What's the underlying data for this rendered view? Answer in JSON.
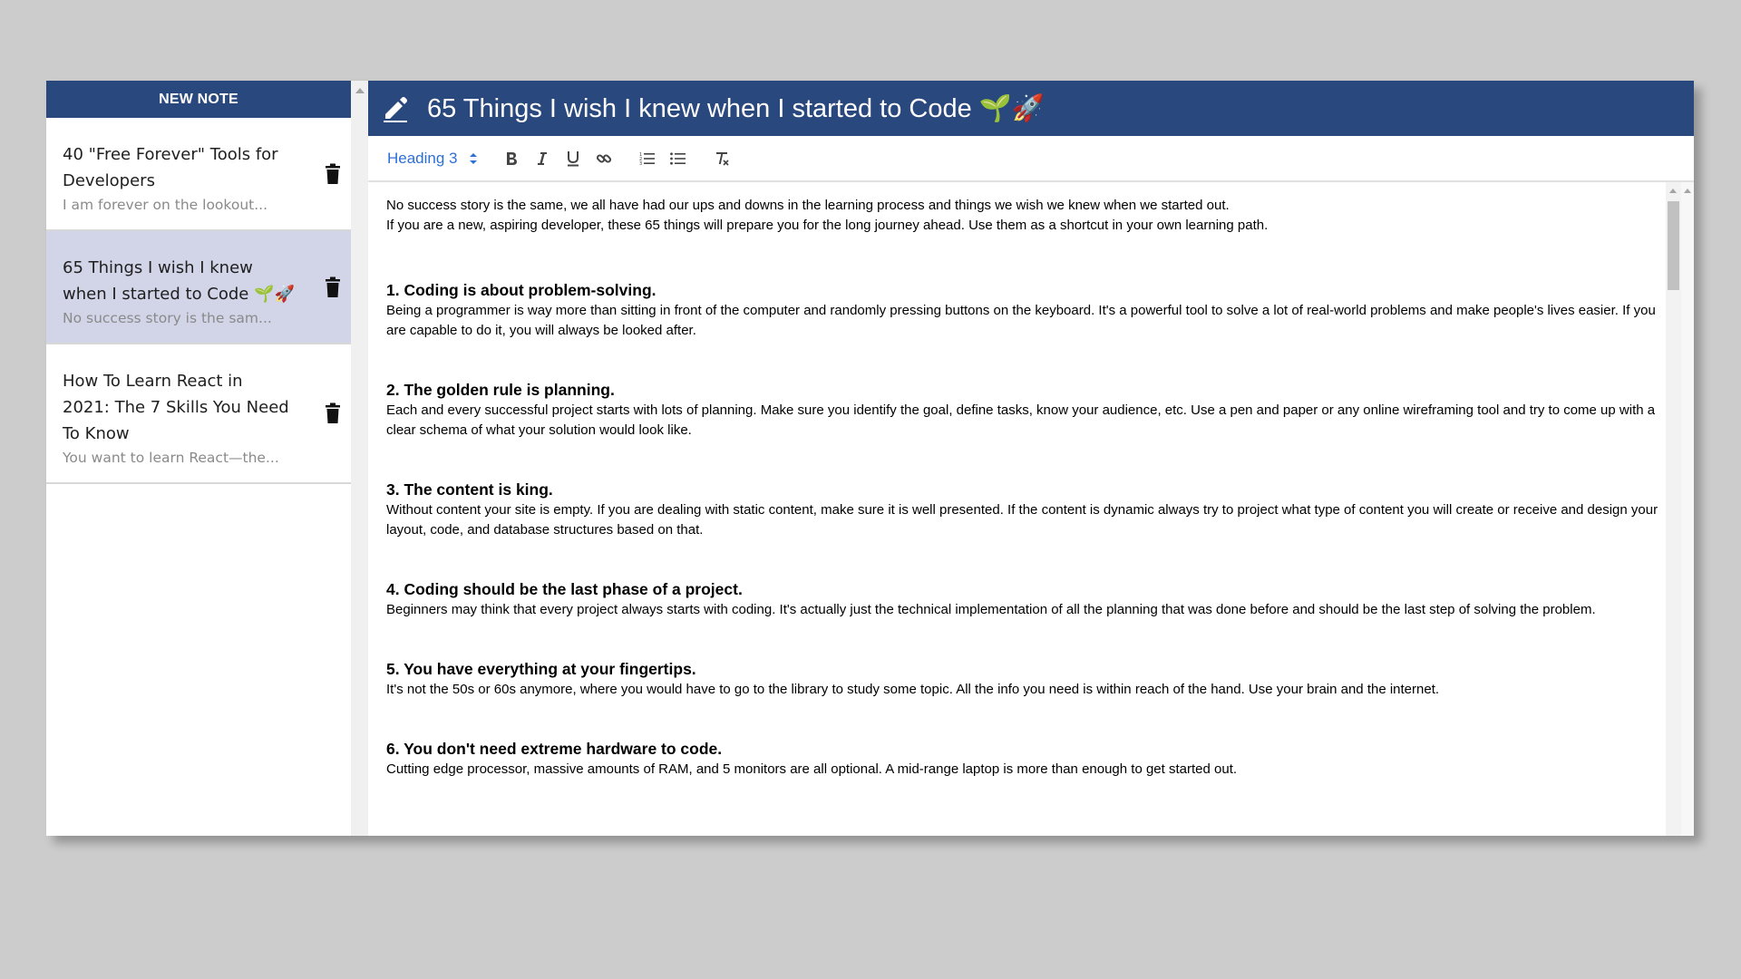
{
  "sidebar": {
    "new_note_label": "NEW NOTE",
    "notes": [
      {
        "title": "40 \"Free Forever\" Tools for Developers",
        "preview": "I am forever on the lookout...",
        "selected": false
      },
      {
        "title": "65 Things I wish I knew when I started to Code 🌱🚀",
        "preview": "No success story is the sam...",
        "selected": true
      },
      {
        "title": "How To Learn React in 2021: The 7 Skills You Need To Know",
        "preview": "You want to learn React—the...",
        "selected": false
      }
    ]
  },
  "editor": {
    "title": "65 Things I wish I knew when I started to Code 🌱🚀",
    "toolbar": {
      "heading_value": "Heading 3",
      "buttons": [
        "bold-icon",
        "italic-icon",
        "underline-icon",
        "link-icon",
        "ordered-list-icon",
        "bullet-list-icon",
        "clear-format-icon"
      ]
    },
    "intro": [
      "No success story is the same, we all have had our ups and downs in the learning process and things we wish we knew when we started out.",
      "If you are a new, aspiring developer, these 65 things will prepare you for the long journey ahead. Use them as a shortcut in your own learning path."
    ],
    "sections": [
      {
        "heading": "1. Coding is about problem-solving.",
        "body": "Being a programmer is way more than sitting in front of the computer and randomly pressing buttons on the keyboard. It's a powerful tool to solve a lot of real-world problems and make people's lives easier. If you are capable to do it, you will always be looked after."
      },
      {
        "heading": "2. The golden rule is planning.",
        "body": "Each and every successful project starts with lots of planning. Make sure you identify the goal, define tasks, know your audience, etc. Use a pen and paper or any online wireframing tool and try to come up with a clear schema of what your solution would look like."
      },
      {
        "heading": "3. The content is king.",
        "body": "Without content your site is empty. If you are dealing with static content, make sure it is well presented. If the content is dynamic always try to project what type of content you will create or receive and design your layout, code, and database structures based on that."
      },
      {
        "heading": "4. Coding should be the last phase of a project.",
        "body": "Beginners may think that every project always starts with coding. It's actually just the technical implementation of all the planning that was done before and should be the last step of solving the problem."
      },
      {
        "heading": "5. You have everything at your fingertips.",
        "body": "It's not the 50s or 60s anymore, where you would have to go to the library to study some topic. All the info you need is within reach of the hand. Use your brain and the internet."
      },
      {
        "heading": "6. You don't need extreme hardware to code.",
        "body": "Cutting edge processor, massive amounts of RAM, and 5 monitors are all optional. A mid-range laptop is more than enough to get started out."
      }
    ]
  },
  "colors": {
    "header_bg": "#29487d",
    "selected_note_bg": "#d2d5e8",
    "heading_select": "#2e6fd6"
  }
}
